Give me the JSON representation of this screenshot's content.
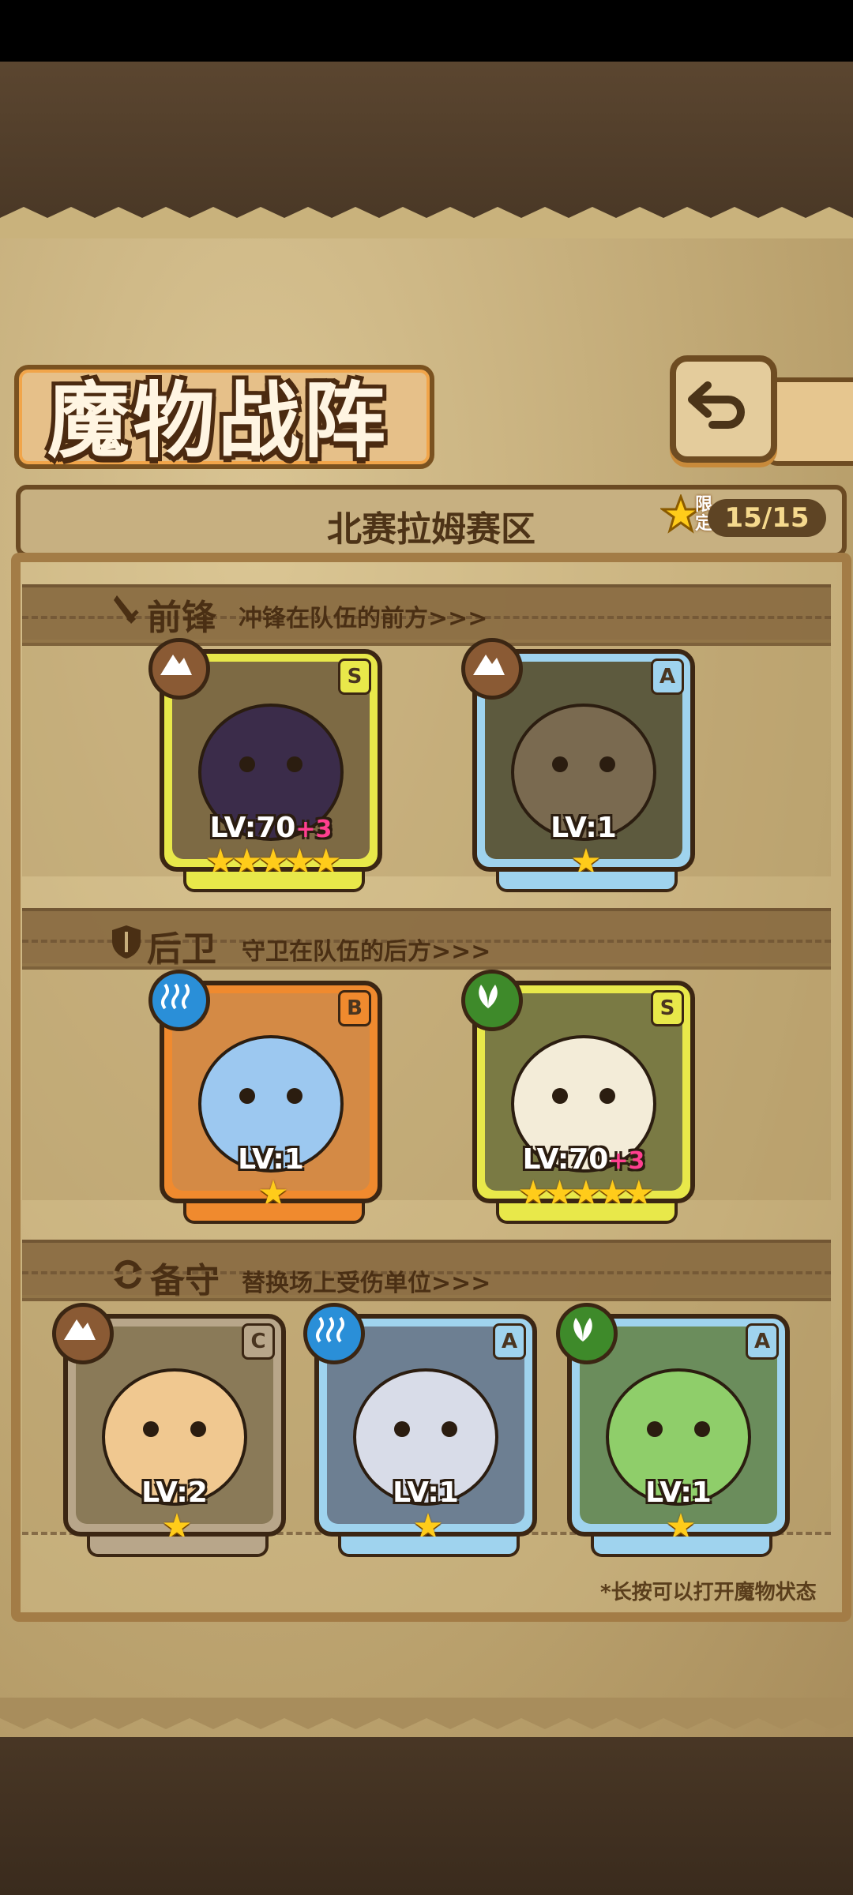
{
  "title": "魔物战阵",
  "region": "北赛拉姆赛区",
  "limit": {
    "label": "限定",
    "count": "15/15"
  },
  "sections": {
    "front": {
      "title": "前锋",
      "subtitle": "冲锋在队伍的前方>>>"
    },
    "back": {
      "title": "后卫",
      "subtitle": "守卫在队伍的后方>>>"
    },
    "reserve": {
      "title": "备守",
      "subtitle": "替换场上受伤单位>>>"
    }
  },
  "cards": [
    {
      "grade": "S",
      "level": "LV:70",
      "bonus": "+3",
      "stars": "★★★★★",
      "element": "earth-icon",
      "border": "#e8e84a"
    },
    {
      "grade": "A",
      "level": "LV:1",
      "bonus": "",
      "stars": "★",
      "element": "earth-icon",
      "border": "#9fd3ee"
    },
    {
      "grade": "B",
      "level": "LV:1",
      "bonus": "",
      "stars": "★",
      "element": "water-icon",
      "border": "#f08a2e"
    },
    {
      "grade": "S",
      "level": "LV:70",
      "bonus": "+3",
      "stars": "★★★★★",
      "element": "leaf-icon",
      "border": "#e8e84a"
    },
    {
      "grade": "C",
      "level": "LV:2",
      "bonus": "",
      "stars": "★",
      "element": "earth-icon",
      "border": "#b8a68a"
    },
    {
      "grade": "A",
      "level": "LV:1",
      "bonus": "",
      "stars": "★",
      "element": "water-icon",
      "border": "#9fd3ee"
    },
    {
      "grade": "A",
      "level": "LV:1",
      "bonus": "",
      "stars": "★",
      "element": "leaf-icon",
      "border": "#9fd3ee"
    }
  ],
  "hint": "*长按可以打开魔物状态",
  "colors": {
    "earth": "#8a5a34",
    "water": "#2a8fd8",
    "leaf": "#3e8a2a"
  }
}
